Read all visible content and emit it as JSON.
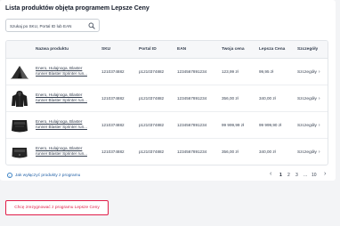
{
  "page": {
    "title": "Lista produktów objęta programem Lepsze Ceny"
  },
  "search": {
    "placeholder": "Szukaj po SKU, Portal ID lub EAN",
    "value": ""
  },
  "table": {
    "headers": [
      "Nazwa produktu",
      "SKU",
      "Portal ID",
      "EAN",
      "Twoja cena",
      "Lepsza Cena",
      "Szczegóły"
    ],
    "rows": [
      {
        "name_line1": "Enero, Hulajnoga, Blaster",
        "name_line2": "runner Blaster Sprinter run...",
        "sku": "1210374882",
        "portal_id": "p1210374882",
        "ean": "1234567891234",
        "your_price": "123,99 zł",
        "better_price": "99,95 zł",
        "details": "Szczegóły",
        "thumb_icon": "tent-icon"
      },
      {
        "name_line1": "Enero, Hulajnoga, Blaster",
        "name_line2": "runner Blaster Sprinter run...",
        "sku": "1210374882",
        "portal_id": "p1210374882",
        "ean": "1234567891234",
        "your_price": "356,00 zł",
        "better_price": "340,00 zł",
        "details": "Szczegóły",
        "thumb_icon": "hooded-jacket-icon"
      },
      {
        "name_line1": "Enero, Hulajnoga, Blaster",
        "name_line2": "runner Blaster Sprinter run...",
        "sku": "1210374882",
        "portal_id": "p1210374882",
        "ean": "1234567891234",
        "your_price": "99 999,99 zł",
        "better_price": "99 999,90 zł",
        "details": "Szczegóły",
        "thumb_icon": "car-hood-icon"
      },
      {
        "name_line1": "Enero, Hulajnoga, Blaster",
        "name_line2": "runner Blaster Sprinter run...",
        "sku": "1210374882",
        "portal_id": "p1210374882",
        "ean": "1234567891234",
        "your_price": "356,00 zł",
        "better_price": "340,00 zł",
        "details": "Szczegóły",
        "thumb_icon": "car-hood-icon"
      }
    ]
  },
  "optout": {
    "label": "Jak wyłączyć produkty z programu",
    "icon": "info-icon"
  },
  "pagination": {
    "pages": [
      "1",
      "2",
      "3",
      "...",
      "10"
    ],
    "current": "1"
  },
  "actions": {
    "join_label": "Chcę zrezygnować z programu Lepsze Ceny"
  },
  "colors": {
    "accent": "#e11d48",
    "link": "#2563a8"
  }
}
